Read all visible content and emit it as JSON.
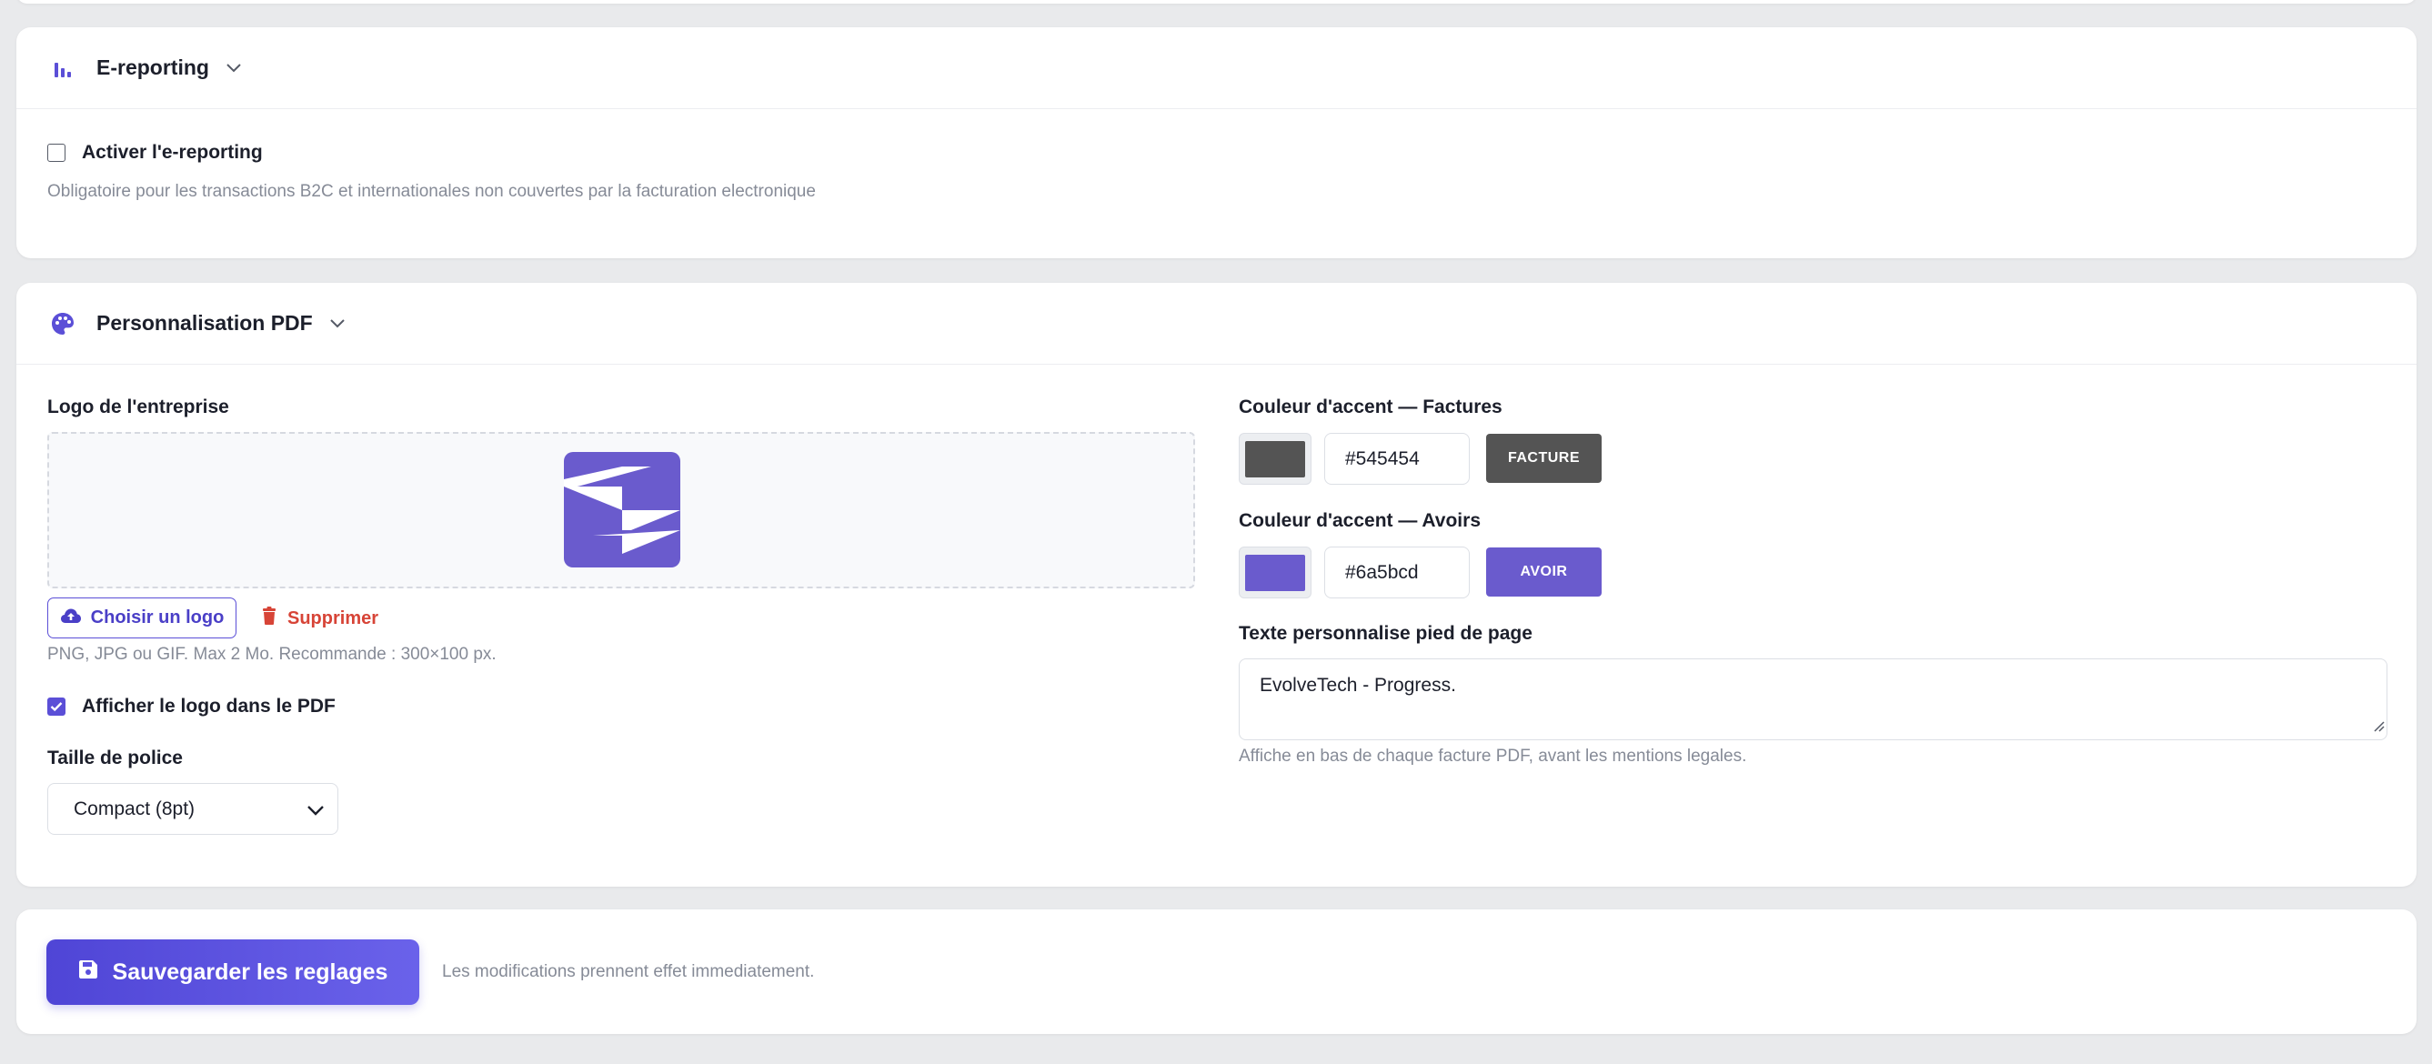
{
  "ereporting": {
    "title": "E-reporting",
    "checkbox_label": "Activer l'e-reporting",
    "checked": false,
    "help": "Obligatoire pour les transactions B2C et internationales non couvertes par la facturation electronique"
  },
  "pdf": {
    "title": "Personnalisation PDF",
    "logo_label": "Logo de l'entreprise",
    "choose_logo": "Choisir un logo",
    "delete": "Supprimer",
    "logo_help": "PNG, JPG ou GIF. Max 2 Mo. Recommande : 300×100 px.",
    "show_logo_label": "Afficher le logo dans le PDF",
    "show_logo_checked": true,
    "font_size_label": "Taille de police",
    "font_size_value": "Compact (8pt)",
    "accent_invoice_label": "Couleur d'accent — Factures",
    "accent_invoice_value": "#545454",
    "accent_invoice_preview": "FACTURE",
    "accent_credit_label": "Couleur d'accent — Avoirs",
    "accent_credit_value": "#6a5bcd",
    "accent_credit_preview": "AVOIR",
    "footer_label": "Texte personnalise pied de page",
    "footer_value": "EvolveTech - Progress.",
    "footer_help": "Affiche en bas de chaque facture PDF, avant les mentions legales."
  },
  "save": {
    "button": "Sauvegarder les reglages",
    "note": "Les modifications prennent effet immediatement."
  },
  "icons": {
    "ereporting": "bar-chart-icon",
    "pdf": "palette-icon",
    "upload": "cloud-upload-icon",
    "delete": "trash-icon",
    "save": "floppy-disk-icon"
  },
  "colors": {
    "brand": "#5b4fd7",
    "danger": "#d74437",
    "invoice_accent": "#545454",
    "credit_accent": "#6a5bcd"
  }
}
